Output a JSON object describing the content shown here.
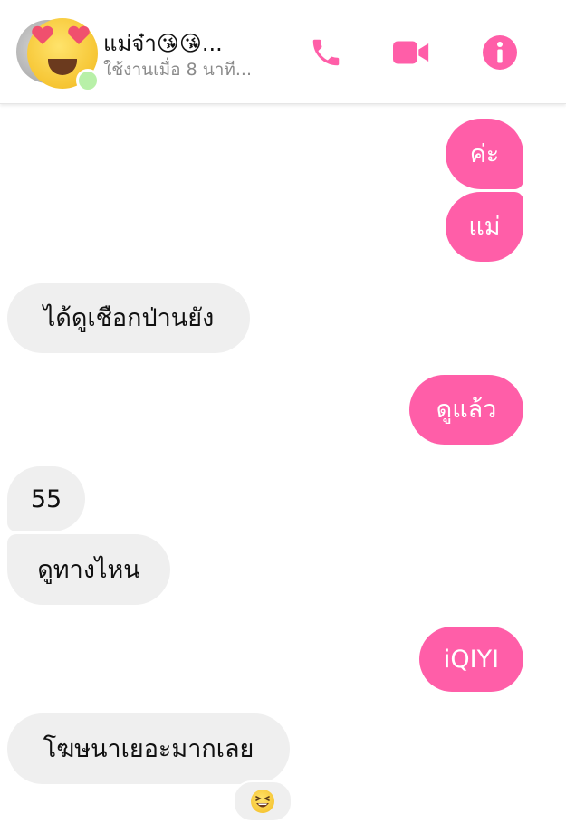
{
  "header": {
    "contact_name": "แม่จ๋า😘😘...",
    "status": "ใช้งานเมื่อ 8 นาที...",
    "avatar_icon": "heart-eyes-emoji-icon",
    "actions": [
      {
        "icon": "phone-icon"
      },
      {
        "icon": "video-camera-icon"
      },
      {
        "icon": "info-icon"
      }
    ],
    "accent_color": "#ff5ea8"
  },
  "messages": [
    {
      "direction": "outgoing",
      "text": "ค่ะ"
    },
    {
      "direction": "outgoing",
      "text": "แม่"
    },
    {
      "direction": "incoming",
      "text": "ได้ดูเชือกป่านยัง"
    },
    {
      "direction": "outgoing",
      "text": "ดูแล้ว"
    },
    {
      "direction": "incoming",
      "text": "55"
    },
    {
      "direction": "incoming",
      "text": "ดูทางไหน"
    },
    {
      "direction": "outgoing",
      "text": "iQIYI"
    },
    {
      "direction": "incoming",
      "text": "โฆษนาเยอะมากเลย"
    }
  ],
  "reaction": {
    "icon": "laughing-emoji-icon"
  },
  "colors": {
    "outgoing_bubble": "#ff5ea8",
    "incoming_bubble": "#efefef"
  }
}
